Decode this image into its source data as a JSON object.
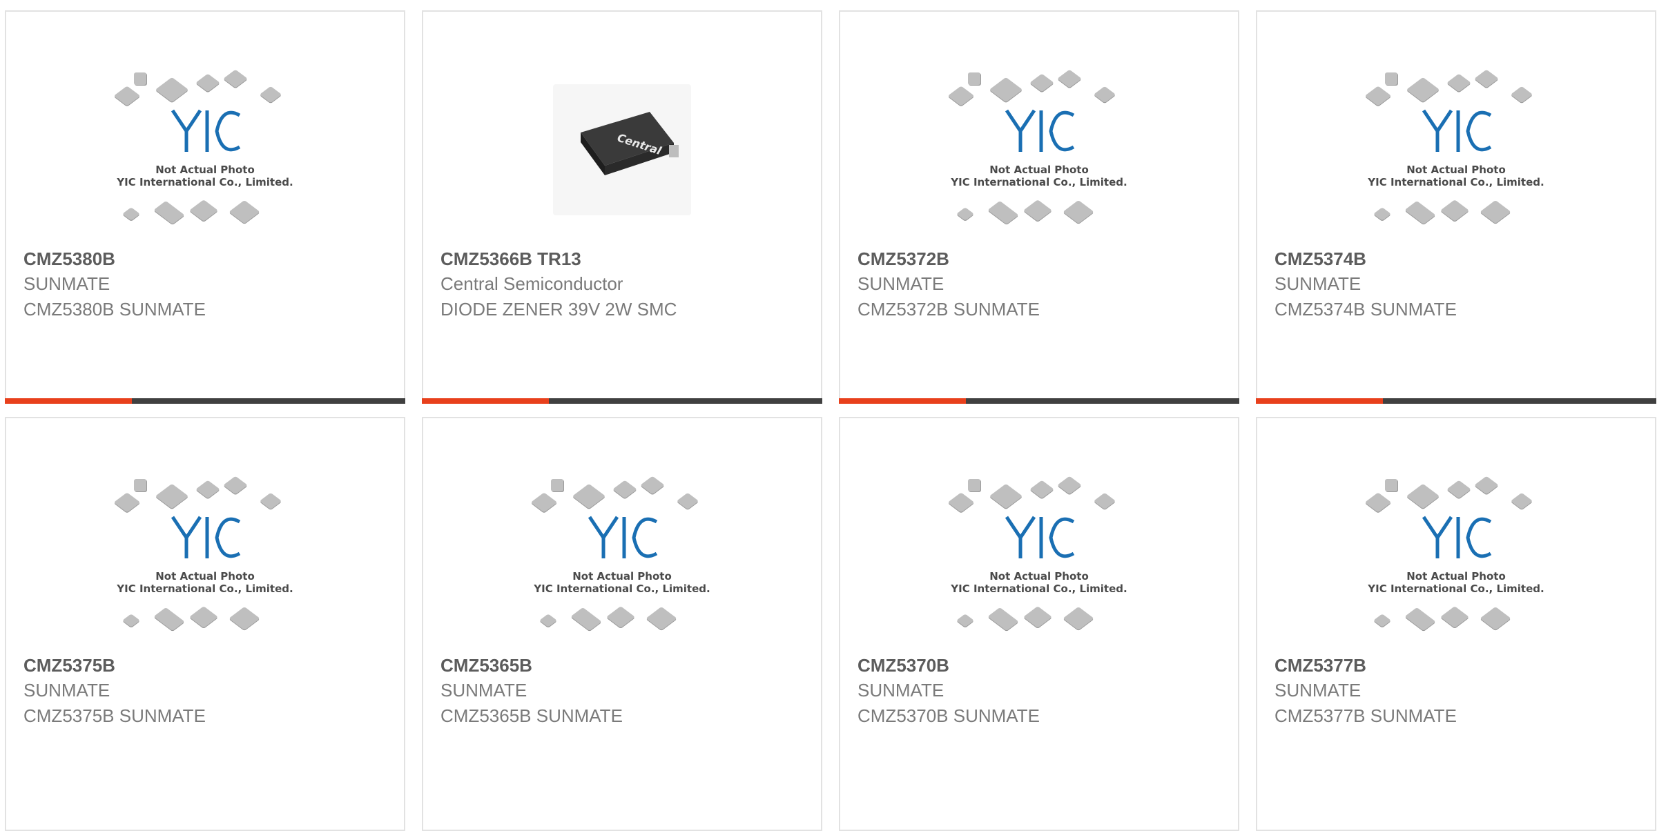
{
  "products": [
    {
      "part": "CMZ5380B",
      "manufacturer": "SUNMATE",
      "description": "CMZ5380B SUNMATE",
      "image": "placeholder"
    },
    {
      "part": "CMZ5366B TR13",
      "manufacturer": "Central Semiconductor",
      "description": "DIODE ZENER 39V 2W SMC",
      "image": "photo"
    },
    {
      "part": "CMZ5372B",
      "manufacturer": "SUNMATE",
      "description": "CMZ5372B SUNMATE",
      "image": "placeholder"
    },
    {
      "part": "CMZ5374B",
      "manufacturer": "SUNMATE",
      "description": "CMZ5374B SUNMATE",
      "image": "placeholder"
    },
    {
      "part": "CMZ5375B",
      "manufacturer": "SUNMATE",
      "description": "CMZ5375B SUNMATE",
      "image": "placeholder"
    },
    {
      "part": "CMZ5365B",
      "manufacturer": "SUNMATE",
      "description": "CMZ5365B SUNMATE",
      "image": "placeholder"
    },
    {
      "part": "CMZ5370B",
      "manufacturer": "SUNMATE",
      "description": "CMZ5370B SUNMATE",
      "image": "placeholder"
    },
    {
      "part": "CMZ5377B",
      "manufacturer": "SUNMATE",
      "description": "CMZ5377B SUNMATE",
      "image": "placeholder"
    }
  ],
  "placeholder": {
    "line1": "Not Actual Photo",
    "line2": "YIC International Co., Limited.",
    "logo_text": "YIC"
  },
  "photo_label": "Central",
  "colors": {
    "accent": "#e8401c",
    "bar": "#404040",
    "border": "#e2e2e2",
    "logo": "#1a6fb3"
  }
}
